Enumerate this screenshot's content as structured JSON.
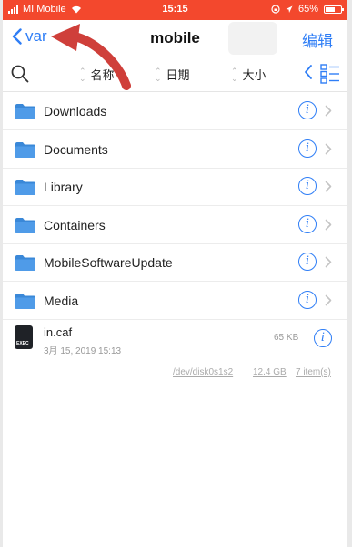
{
  "status_bar": {
    "carrier": "MI Mobile",
    "time": "15:15",
    "battery_percent": "65%",
    "battery_level": 0.65,
    "accent_color": "#f3482d"
  },
  "nav": {
    "back_label": "var",
    "title": "mobile",
    "edit_label": "编辑"
  },
  "toolbar": {
    "sort_name": "名称",
    "sort_date": "日期",
    "sort_size": "大小"
  },
  "folders": [
    {
      "name": "Downloads"
    },
    {
      "name": "Documents"
    },
    {
      "name": "Library"
    },
    {
      "name": "Containers"
    },
    {
      "name": "MobileSoftwareUpdate"
    },
    {
      "name": "Media"
    }
  ],
  "file": {
    "name": "in.caf",
    "date": "3月 15, 2019 15:13",
    "size": "65 KB",
    "icon_label": "EXEC"
  },
  "footer": {
    "device": "/dev/disk0s1s2",
    "capacity": "12.4 GB",
    "items": "7 item(s)"
  },
  "icons": {
    "folder": "folder-icon",
    "info": "info-icon",
    "chevron": "chevron-right-icon",
    "search": "search-icon",
    "grid": "grid-view-icon"
  },
  "info_glyph": "i"
}
